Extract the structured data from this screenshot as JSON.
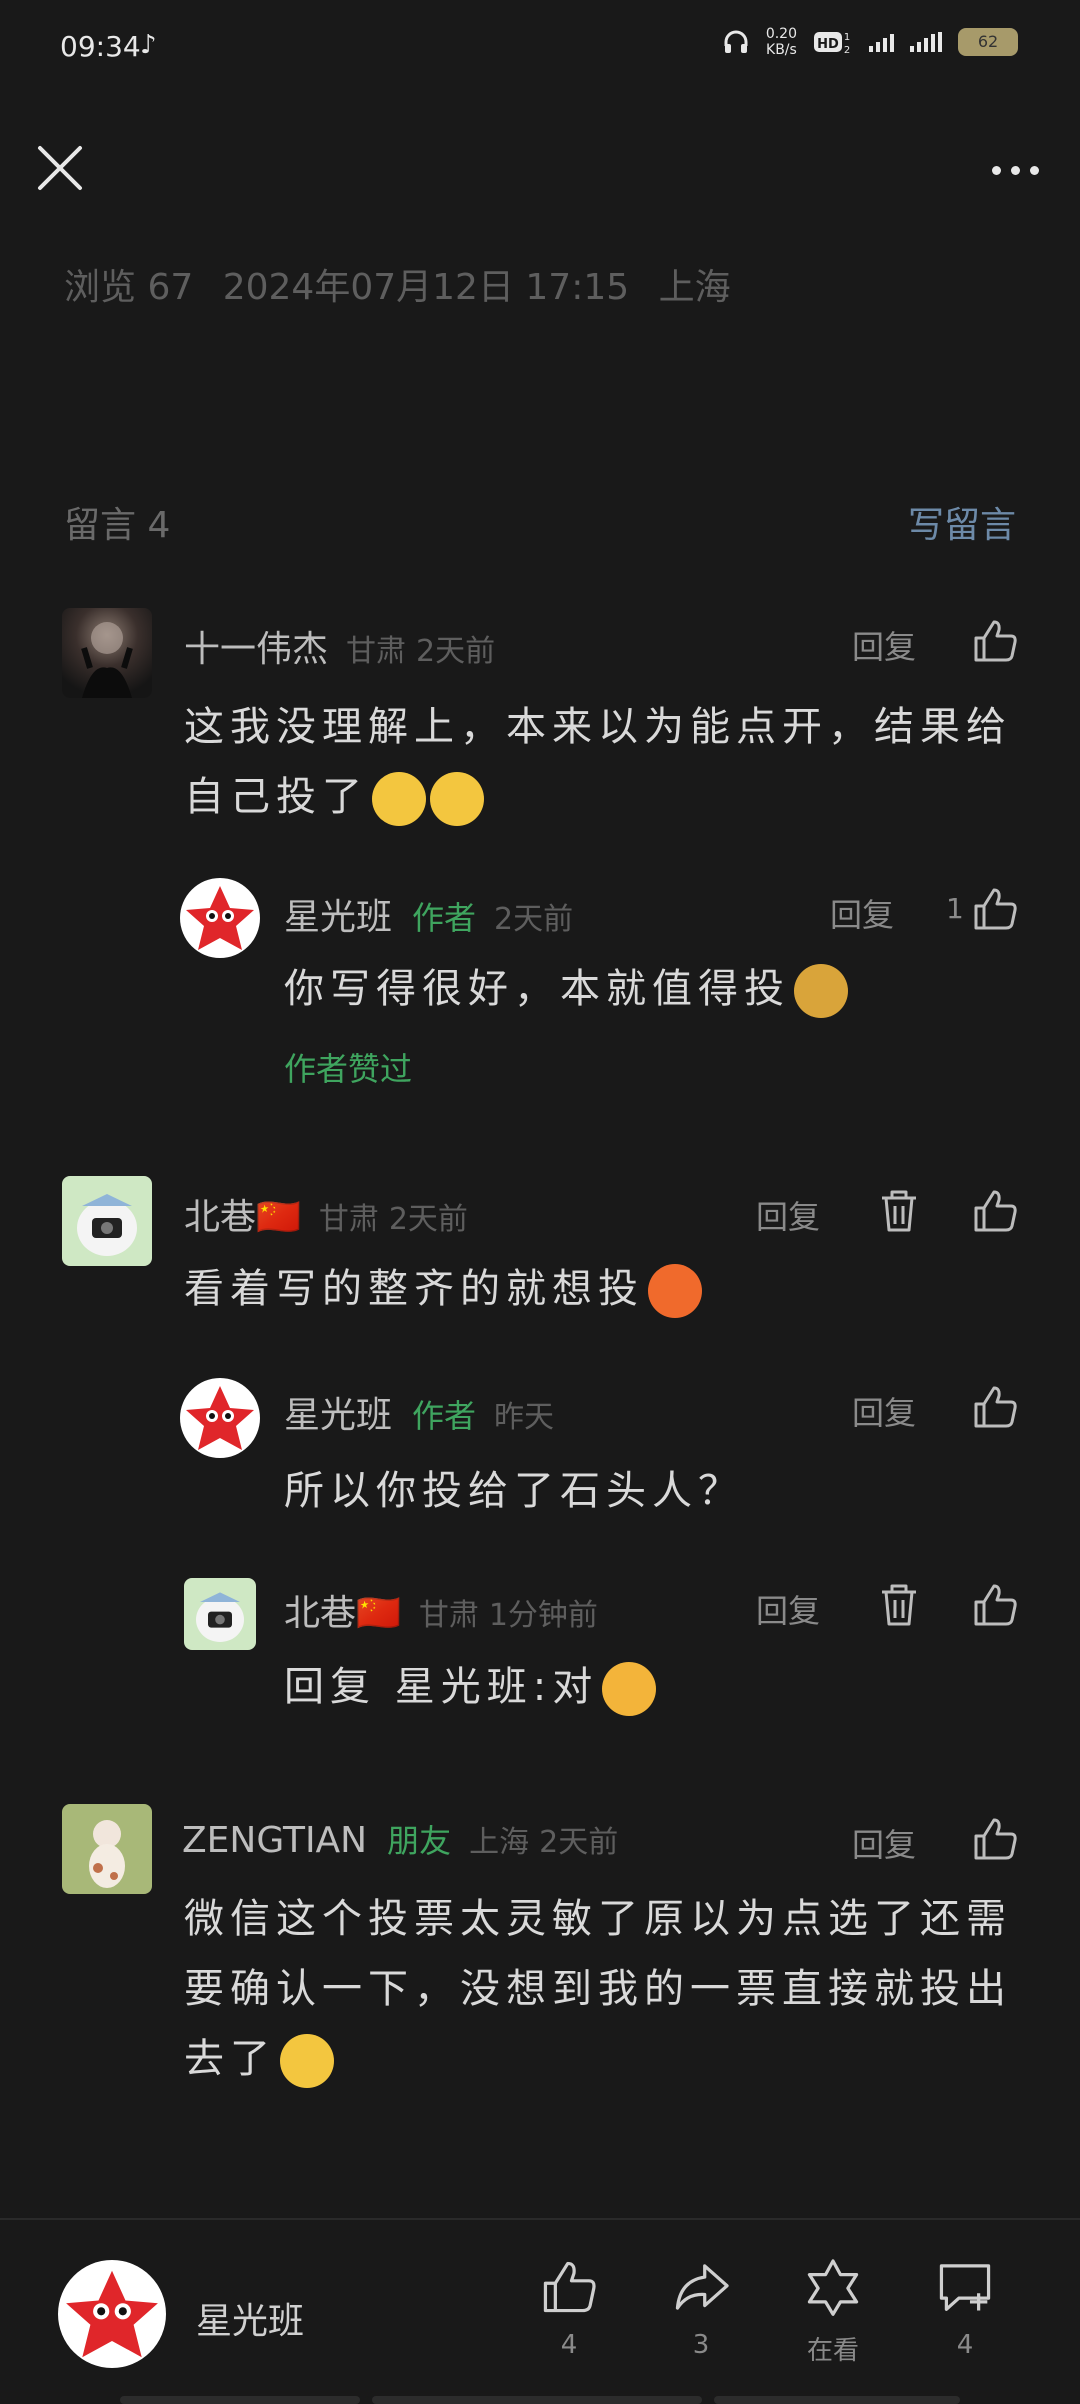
{
  "status": {
    "time": "09:34",
    "net_speed_value": "0.20",
    "net_speed_unit": "KB/s",
    "battery": "62"
  },
  "top": {
    "close_icon": "close-icon",
    "more_icon": "more-icon"
  },
  "meta": {
    "views": "浏览 67",
    "date": "2024年07月12日 17:15",
    "location": "上海"
  },
  "comments_section": {
    "count_label": "留言 4",
    "write_label": "写留言"
  },
  "comments": [
    {
      "name": "十一伟杰",
      "location": "甘肃",
      "time": "2天前",
      "reply": "回复",
      "text": "这我没理解上，本来以为能点开，结果给自己投了",
      "replies": [
        {
          "name": "星光班",
          "tag": "作者",
          "time": "2天前",
          "reply": "回复",
          "likes": "1",
          "text": "你写得很好，本就值得投",
          "author_liked": "作者赞过"
        }
      ]
    },
    {
      "name": "北巷🇨🇳",
      "location": "甘肃",
      "time": "2天前",
      "reply": "回复",
      "text": "看着写的整齐的就想投",
      "replies": [
        {
          "name": "星光班",
          "tag": "作者",
          "time": "昨天",
          "reply": "回复",
          "text": "所以你投给了石头人？"
        },
        {
          "name": "北巷🇨🇳",
          "location": "甘肃",
          "time": "1分钟前",
          "reply": "回复",
          "text": "回复 星光班:对"
        }
      ]
    },
    {
      "name": "ZENGTIAN",
      "tag": "朋友",
      "location": "上海",
      "time": "2天前",
      "reply": "回复",
      "text": "微信这个投票太灵敏了原以为点选了还需要确认一下，没想到我的一票直接就投出去了"
    }
  ],
  "bottom": {
    "account_name": "星光班",
    "like_count": "4",
    "share_count": "3",
    "watching_label": "在看",
    "comment_count": "4"
  }
}
